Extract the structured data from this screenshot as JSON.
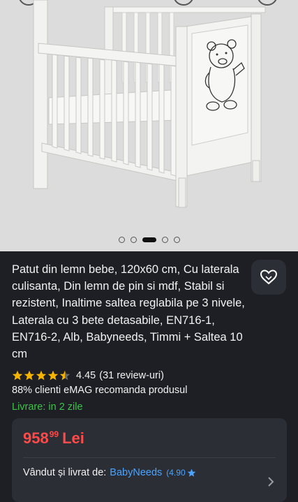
{
  "gallery": {
    "image_alt": "White wooden baby crib with teddy bear panel",
    "slides_count": 5,
    "active_slide": 2
  },
  "product": {
    "title": "Patut din lemn bebe, 120x60 cm, Cu laterala culisanta, Din lemn de pin si mdf, Stabil si rezistent, Inaltime saltea reglabila pe 3 nivele, Laterala cu 3 bete detasabile, EN716-1, EN716-2, Alb, Babyneeds, Timmi + Saltea 10 cm",
    "rating_value": "4.45",
    "reviews": "(31 review-uri)",
    "rating_stars": 4.45,
    "recommend": "88% clienti eMAG recomanda produsul",
    "delivery": "Livrare: in 2 zile"
  },
  "offer": {
    "price_int": "958",
    "price_dec": "99",
    "currency": "Lei",
    "seller_label": "Vândut și livrat de:",
    "seller_name": "BabyNeeds",
    "seller_score": "(4.90"
  },
  "colors": {
    "price": "#ff4a4a",
    "delivery": "#3ec24a",
    "link": "#4aa3ff",
    "star": "#f5b400"
  }
}
